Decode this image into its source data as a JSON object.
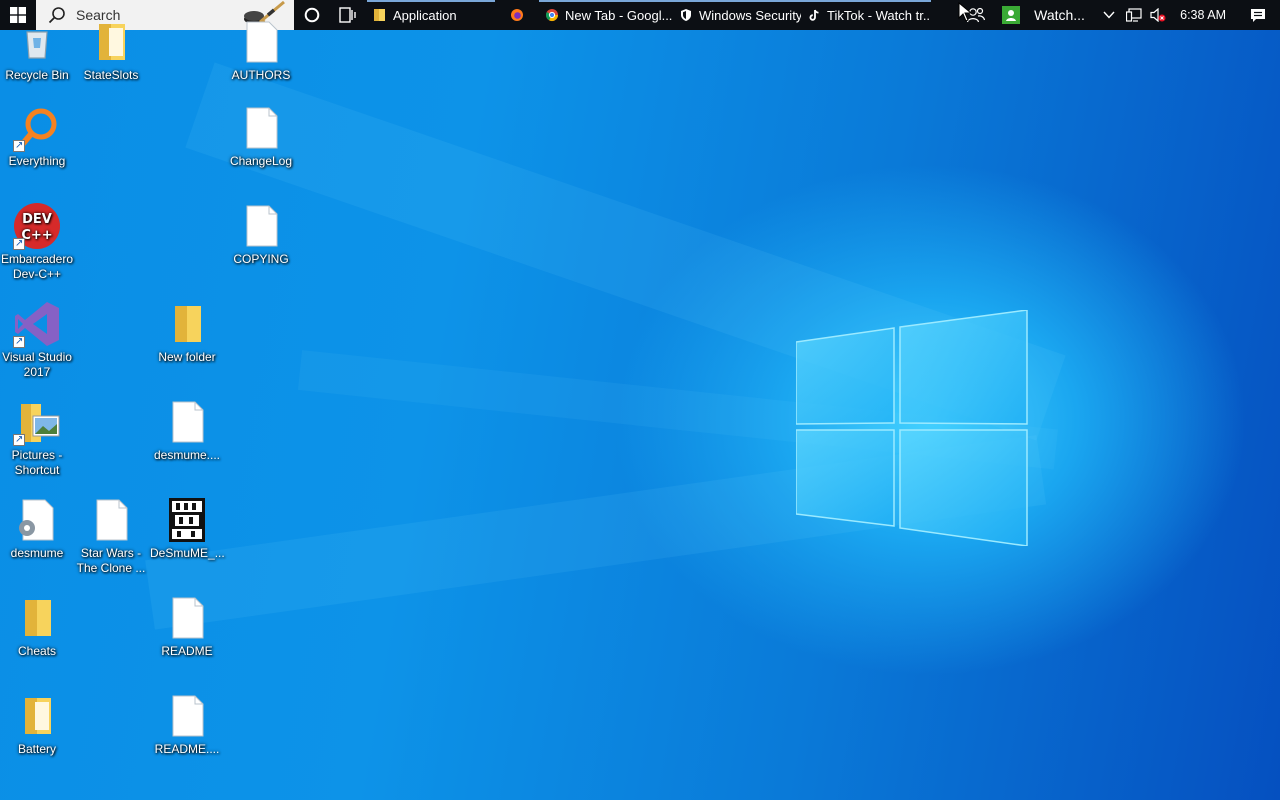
{
  "taskbar": {
    "search_placeholder": "Search",
    "tasks": [
      {
        "label": "Application",
        "icon": "folder-icon"
      },
      {
        "label": "",
        "icon": "firefox-icon"
      },
      {
        "label": "New Tab - Googl...",
        "icon": "chrome-icon"
      },
      {
        "label": "Windows Security",
        "icon": "shield-icon"
      },
      {
        "label": "TikTok - Watch tr...",
        "icon": "tiktok-icon"
      },
      {
        "label": "Watch...",
        "icon": "green-app-icon"
      }
    ],
    "clock": "6:38 AM"
  },
  "desktop": {
    "icons": [
      {
        "label": "Recycle Bin"
      },
      {
        "label": "StateSlots"
      },
      {
        "label": "AUTHORS"
      },
      {
        "label": "Everything"
      },
      {
        "label": "ChangeLog"
      },
      {
        "label": "Embarcadero Dev-C++"
      },
      {
        "label": "COPYING"
      },
      {
        "label": "Visual Studio 2017"
      },
      {
        "label": "New folder"
      },
      {
        "label": "Pictures - Shortcut"
      },
      {
        "label": "desmume...."
      },
      {
        "label": "desmume"
      },
      {
        "label": "Star Wars - The Clone ..."
      },
      {
        "label": "DeSmuME_..."
      },
      {
        "label": "Cheats"
      },
      {
        "label": "README"
      },
      {
        "label": "Battery"
      },
      {
        "label": "README...."
      }
    ]
  },
  "colors": {
    "taskbar_bg": "#0c0f14",
    "desktop_blue": "#0a8ee6",
    "folder_yellow": "#f7d35c"
  }
}
